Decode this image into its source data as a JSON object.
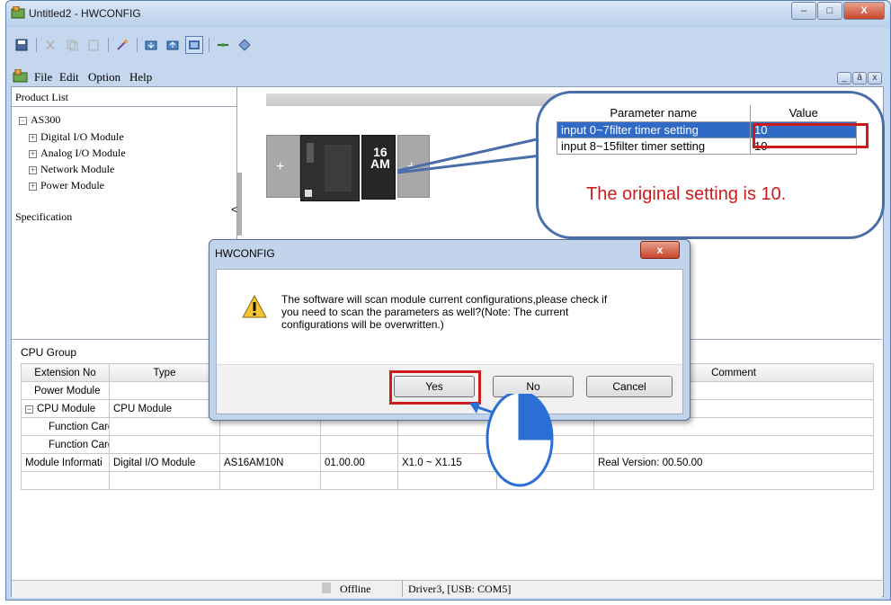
{
  "window": {
    "title": "Untitled2 - HWCONFIG",
    "caption_buttons": [
      "–",
      "□",
      "X"
    ],
    "mdi_buttons": [
      "_",
      "ā",
      "x"
    ]
  },
  "menu": {
    "items": [
      "File",
      "Edit",
      "Option",
      "Help"
    ]
  },
  "product_panel": {
    "title": "Product List",
    "root": "AS300",
    "items": [
      "Digital I/O Module",
      "Analog I/O Module",
      "Network Module",
      "Power Module"
    ],
    "spec_label": "Specification",
    "collapse_glyph": "<"
  },
  "rack": {
    "plus_glyph": "+",
    "card_label_top": "16",
    "card_label_bottom": "AM"
  },
  "callout": {
    "headers": [
      "Parameter name",
      "Value"
    ],
    "rows": [
      {
        "name": "input 0~7filter timer setting",
        "value": "10"
      },
      {
        "name": "input 8~15filter timer setting",
        "value": "10"
      }
    ],
    "note": "The original setting is 10.",
    "accent_color": "#cc1b1b",
    "border_color": "#4a6ea9",
    "selected_row_color": "#3169c6"
  },
  "cpu_group": {
    "title": "CPU Group",
    "columns": [
      "Extension No",
      "Type",
      "",
      "",
      "",
      "",
      "Comment"
    ],
    "rows": [
      [
        "Power Module",
        "",
        "",
        "",
        "",
        "",
        ""
      ],
      [
        "CPU Module",
        "CPU Module",
        "",
        "",
        "",
        "",
        ""
      ],
      [
        "Function Card",
        "",
        "",
        "",
        "",
        "",
        ""
      ],
      [
        "Function Card",
        "",
        "",
        "",
        "",
        "",
        ""
      ],
      [
        "Module Informati",
        "Digital I/O Module",
        "AS16AM10N",
        "01.00.00",
        "X1.0 ~ X1.15",
        "",
        "Real Version: 00.50.00"
      ]
    ]
  },
  "status_bar": {
    "state": "Offline",
    "driver": "Driver3, [USB: COM5]"
  },
  "dialog": {
    "title": "HWCONFIG",
    "close_glyph": "x",
    "icon": "warning-icon",
    "message_lines": [
      "The software will scan module current configurations,please check if",
      "you need to scan the parameters as well?(Note: The current",
      "configurations will be overwritten.)"
    ],
    "buttons": {
      "yes": "Yes",
      "no": "No",
      "cancel": "Cancel"
    }
  }
}
